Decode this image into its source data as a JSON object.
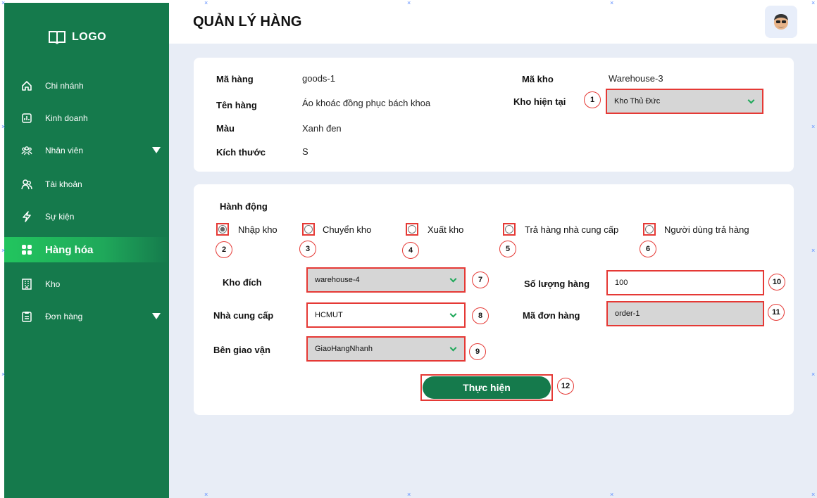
{
  "sidebar": {
    "logo_text": "LOGO",
    "items": [
      {
        "label": "Chi nhánh",
        "icon": "home-icon"
      },
      {
        "label": "Kinh doanh",
        "icon": "chart-icon"
      },
      {
        "label": "Nhân viên",
        "icon": "people-icon"
      },
      {
        "label": "Tài khoản",
        "icon": "user-group-icon"
      },
      {
        "label": "Sự kiện",
        "icon": "lightning-icon"
      },
      {
        "label": "Hàng hóa",
        "icon": "grid-icon"
      },
      {
        "label": "Kho",
        "icon": "building-icon"
      },
      {
        "label": "Đơn hàng",
        "icon": "clipboard-icon"
      }
    ]
  },
  "header": {
    "title": "QUẢN LÝ HÀNG"
  },
  "info": {
    "ma_hang_label": "Mã hàng",
    "ma_hang_value": "goods-1",
    "ten_hang_label": "Tên hàng",
    "ten_hang_value": "Áo khoác đồng phục bách khoa",
    "mau_label": "Màu",
    "mau_value": "Xanh đen",
    "kich_thuoc_label": "Kích thước",
    "kich_thuoc_value": "S",
    "ma_kho_label": "Mã kho",
    "ma_kho_value": "Warehouse-3",
    "kho_hien_tai_label": "Kho hiện tại",
    "kho_hien_tai_value": "Kho Thủ Đức"
  },
  "action": {
    "heading": "Hành động",
    "radios": [
      {
        "label": "Nhập kho",
        "checked": true,
        "marker": "2"
      },
      {
        "label": "Chuyển kho",
        "checked": false,
        "marker": "3"
      },
      {
        "label": "Xuất kho",
        "checked": false,
        "marker": "4"
      },
      {
        "label": "Trả hàng nhà cung cấp",
        "checked": false,
        "marker": "5"
      },
      {
        "label": "Người dùng trả hàng",
        "checked": false,
        "marker": "6"
      }
    ],
    "kho_dich_label": "Kho đích",
    "kho_dich_value": "warehouse-4",
    "nha_cung_cap_label": "Nhà cung cấp",
    "nha_cung_cap_value": "HCMUT",
    "ben_giao_van_label": "Bên giao vận",
    "ben_giao_van_value": "GiaoHangNhanh",
    "so_luong_label": "Số lượng hàng",
    "so_luong_value": "100",
    "ma_don_label": "Mã đơn hàng",
    "ma_don_value": "order-1",
    "submit_label": "Thực hiện"
  },
  "markers": {
    "m1": "1",
    "m2": "2",
    "m3": "3",
    "m4": "4",
    "m5": "5",
    "m6": "6",
    "m7": "7",
    "m8": "8",
    "m9": "9",
    "m10": "10",
    "m11": "11",
    "m12": "12"
  },
  "colors": {
    "sidebar": "#157a4c",
    "active_item": "#22c55e",
    "highlight_border": "#e53935",
    "background": "#e8edf6"
  }
}
